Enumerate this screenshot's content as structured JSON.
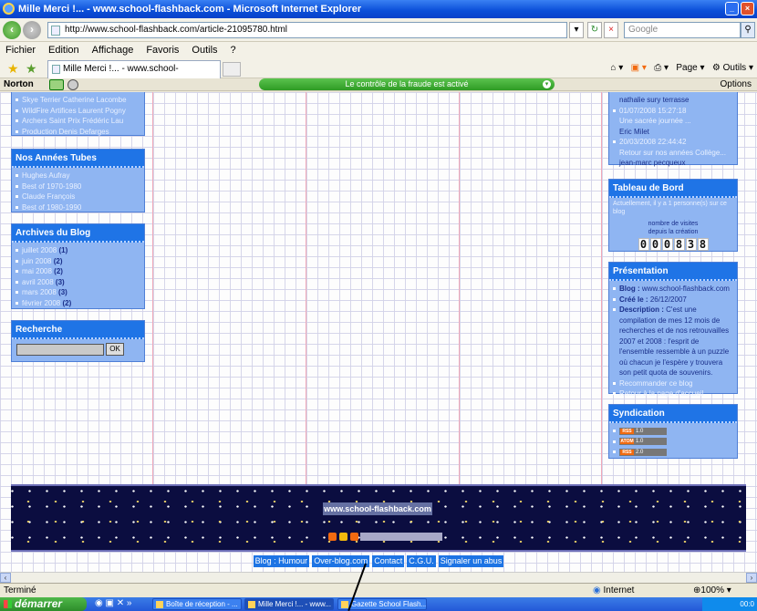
{
  "window": {
    "title": "Mille Merci !... - www.school-flashback.com - Microsoft Internet Explorer"
  },
  "address": {
    "url": "http://www.school-flashback.com/article-21095780.html",
    "search_placeholder": "Google"
  },
  "menu": [
    "Fichier",
    "Edition",
    "Affichage",
    "Favoris",
    "Outils",
    "?"
  ],
  "tab": {
    "label": "Mille Merci !... - www.school-flashback.com"
  },
  "toolbar": {
    "page": "Page",
    "tools": "Outils"
  },
  "norton": {
    "logo": "Norton",
    "fraud_label": "Le contrôle de la fraude est activé",
    "options": "Options"
  },
  "left": {
    "top_links": [
      "Skye Terrier Catherine Lacombe",
      "WildFire Artifices Laurent Pogny",
      "Archers Saint Prix Frédéric Lau",
      "Production Denis Defarges"
    ],
    "tubes": {
      "title": "Nos Années Tubes",
      "items": [
        "Hughes Aufray",
        "Best of 1970-1980",
        "Claude François",
        "Best of 1980-1990"
      ]
    },
    "archives": {
      "title": "Archives du Blog",
      "items": [
        {
          "month": "juillet 2008",
          "count": "(1)"
        },
        {
          "month": "juin 2008",
          "count": "(2)"
        },
        {
          "month": "mai 2008",
          "count": "(2)"
        },
        {
          "month": "avril 2008",
          "count": "(3)"
        },
        {
          "month": "mars 2008",
          "count": "(3)"
        },
        {
          "month": "février 2008",
          "count": "(2)"
        }
      ]
    },
    "search": {
      "title": "Recherche",
      "button": "OK"
    }
  },
  "right": {
    "comments": [
      "nathalie sury terrasse",
      "01/07/2008 15:27:18",
      "Une sacrée journée ...",
      "Eric Milet",
      "20/03/2008 22:44:42",
      "Retour sur nos années Collège...",
      "jean-marc pecqueux"
    ],
    "tableau": {
      "title": "Tableau de Bord",
      "line": "Actuellement, il y a 1 personne(s) sur ce blog",
      "counter_label1": "nombre de visites",
      "counter_label2": "depuis la création",
      "digits": [
        "0",
        "0",
        "0",
        "8",
        "3",
        "8"
      ]
    },
    "presentation": {
      "title": "Présentation",
      "blog_label": "Blog :",
      "blog_value": "www.school-flashback.com",
      "created_label": "Créé le :",
      "created_value": "26/12/2007",
      "desc_label": "Description :",
      "desc_value": "C'est une compilation de mes 12 mois de recherches et de nos retrouvailles 2007 et 2008 : l'esprit de l'ensemble ressemble à un puzzle où chacun je l'espère y trouvera son petit quota de souvenirs.",
      "link1": "Recommander ce blog",
      "link2": "Retour à la page d'accueil"
    },
    "syndication": {
      "title": "Syndication",
      "feeds": [
        {
          "tag": "RSS",
          "ver": "1.0"
        },
        {
          "tag": "ATOM",
          "ver": "1.0"
        },
        {
          "tag": "RSS",
          "ver": "2.0"
        }
      ]
    }
  },
  "banner": {
    "title": "www.school-flashback.com"
  },
  "footer": [
    "Blog : Humour",
    "Over-blog.com",
    "Contact",
    "C.G.U.",
    "Signaler un abus"
  ],
  "status": {
    "left": "Terminé",
    "zone": "Internet",
    "zoom": "100%"
  },
  "taskbar": {
    "start": "démarrer",
    "items": [
      "Boîte de réception - ...",
      "Mille Merci !... - www...",
      "Gazette School Flash..."
    ],
    "clock": "00:0"
  }
}
